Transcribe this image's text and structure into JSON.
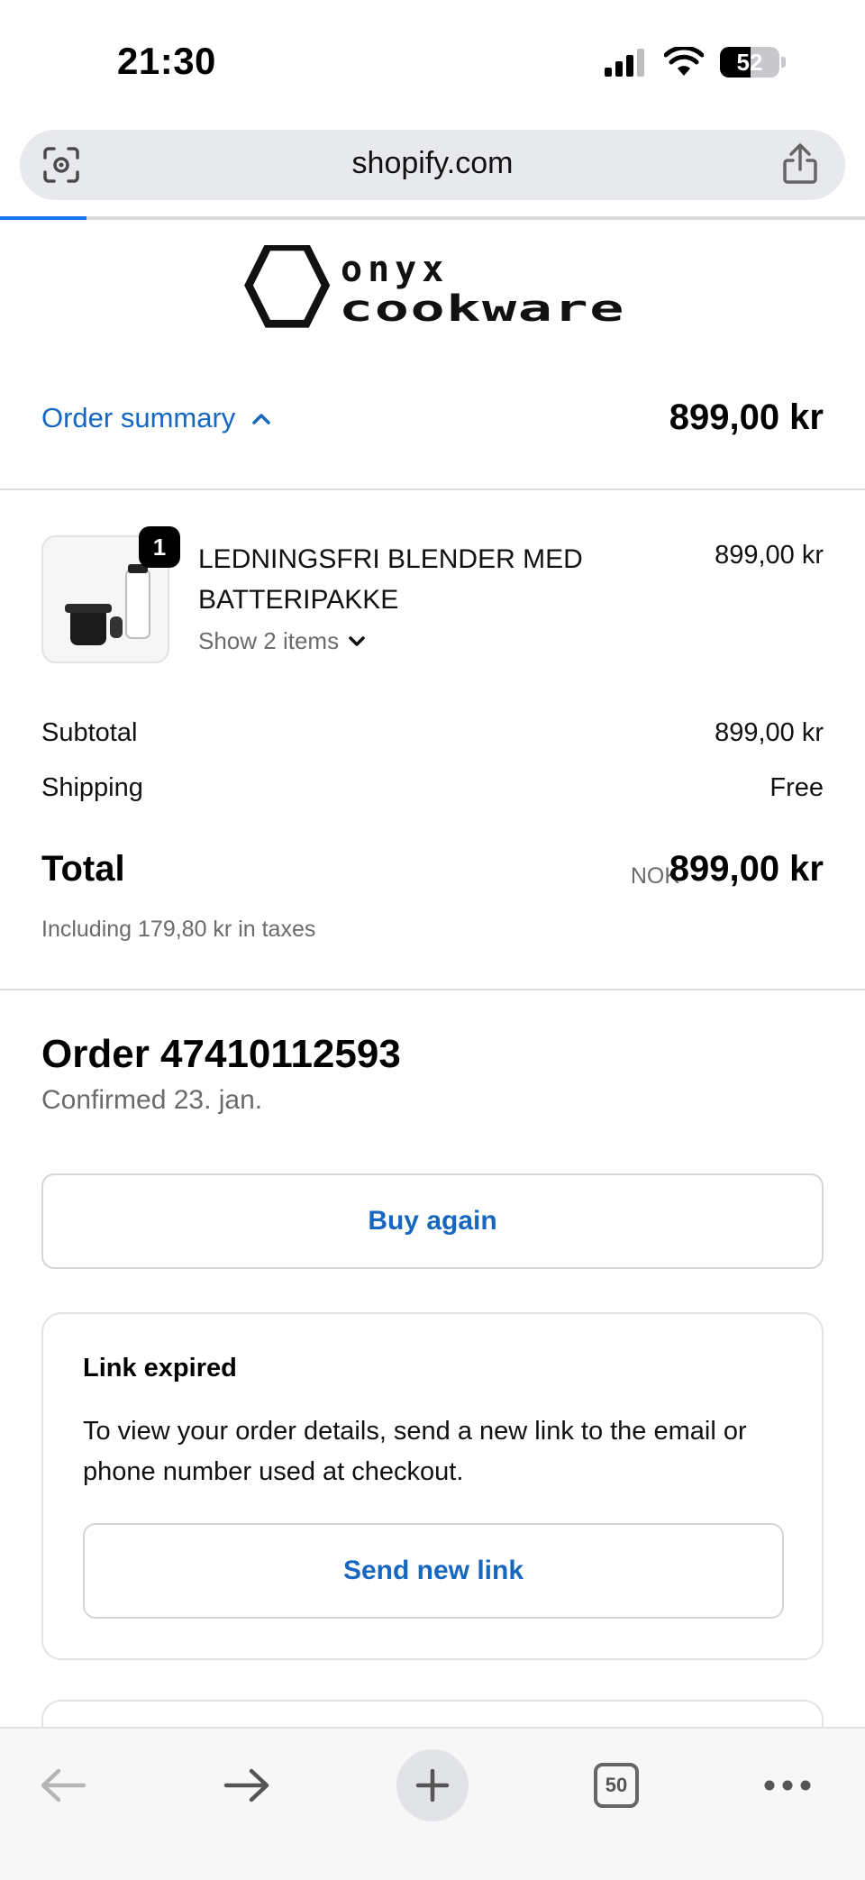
{
  "status_bar": {
    "time": "21:30",
    "battery": "52",
    "battery_level": 0.52
  },
  "browser": {
    "url": "shopify.com",
    "load_progress": 0.1,
    "tab_count": "50"
  },
  "store": {
    "logo_line1": "onyx",
    "logo_line2": "cookware"
  },
  "summary": {
    "toggle_label": "Order summary",
    "total": "899,00 kr"
  },
  "product": {
    "quantity": "1",
    "name": "LEDNINGSFRI BLENDER MED BATTERIPAKKE",
    "show_items": "Show 2 items",
    "price": "899,00 kr"
  },
  "costs": {
    "subtotal_label": "Subtotal",
    "subtotal_value": "899,00 kr",
    "shipping_label": "Shipping",
    "shipping_value": "Free",
    "total_label": "Total",
    "total_currency": "NOK",
    "total_value": "899,00 kr",
    "taxes_note": "Including 179,80 kr in taxes"
  },
  "order": {
    "title": "Order 47410112593",
    "confirmed": "Confirmed 23. jan.",
    "buy_again_label": "Buy again"
  },
  "link_card": {
    "title": "Link expired",
    "text": "To view your order details, send a new link to the email or phone number used at checkout.",
    "button_label": "Send new link"
  },
  "colors": {
    "accent": "#1667c0",
    "progress": "#1a73e8",
    "muted": "#6b6b6b"
  },
  "toolbar_icons": [
    "back-arrow-icon",
    "forward-arrow-icon",
    "plus-icon",
    "tabs-icon",
    "more-icon"
  ]
}
